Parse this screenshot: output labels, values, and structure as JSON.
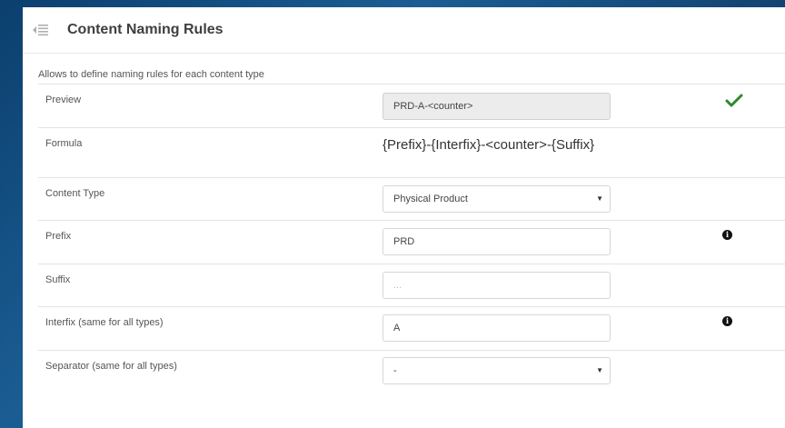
{
  "header": {
    "title": "Content Naming Rules",
    "menu_icon": "collapse-menu-icon"
  },
  "description": "Allows to define naming rules for each content type",
  "rows": {
    "preview": {
      "label": "Preview",
      "value": "PRD-A-<counter>",
      "status_icon": "checkmark-icon",
      "status_color": "#2a8a2a"
    },
    "formula": {
      "label": "Formula",
      "value": "{Prefix}-{Interfix}-<counter>-{Suffix}"
    },
    "content_type": {
      "label": "Content Type",
      "value": "Physical Product"
    },
    "prefix": {
      "label": "Prefix",
      "value": "PRD",
      "info_icon": "info-icon"
    },
    "suffix": {
      "label": "Suffix",
      "placeholder": "..."
    },
    "interfix": {
      "label": "Interfix (same for all types)",
      "value": "A",
      "info_icon": "info-icon"
    },
    "separator": {
      "label": "Separator (same for all types)",
      "value": "-"
    }
  },
  "info_glyph": "i"
}
